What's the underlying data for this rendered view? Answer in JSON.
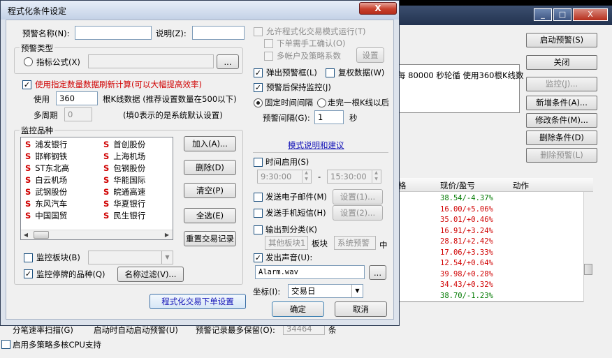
{
  "dialog": {
    "title": "程式化条件设定",
    "close_symbol": "X",
    "alert_name_label": "预警名称(N):",
    "alert_name_value": "",
    "description_label": "说明(Z):",
    "description_value": "",
    "alert_type": {
      "group_title": "预警类型",
      "formula_label": "指标公式(X)",
      "formula_value": "",
      "browse_label": "..."
    },
    "refresh": {
      "checkbox_label": "使用指定数量数据刷新计算(可以大幅提高效率)",
      "use_label": "使用",
      "count_value": "360",
      "count_suffix": "根K线数据 (推荐设置数量在500以下)",
      "multi_period_label": "多周期",
      "multi_period_value": "0",
      "multi_period_hint": "(填0表示的是系统默认设置)"
    },
    "stocks": {
      "group_title": "监控品种",
      "column_left": [
        "浦发银行",
        "邯郸钢铁",
        "ST东北高",
        "白云机场",
        "武钢股份",
        "东风汽车",
        "中国国贸"
      ],
      "column_right": [
        "首创股份",
        "上海机场",
        "包钢股份",
        "华能国际",
        "皖通高速",
        "华夏银行",
        "民生银行"
      ],
      "marker": "S",
      "buttons": [
        "加入(A)...",
        "删除(D)",
        "清空(P)",
        "全选(E)",
        "重置交易记录"
      ],
      "monitor_sector_label": "监控板块(B)",
      "monitor_sector_value": "",
      "monitor_suspended_label": "监控停牌的品种(Q)",
      "name_filter_label": "名称过滤(V)..."
    },
    "order_settings_button": "程式化交易下单设置",
    "right": {
      "allow_trade_mode_label": "允许程式化交易模式运行(T)",
      "manual_confirm_label": "下单需手工确认(O)",
      "multi_account_label": "多帐户及策略系数",
      "settings_button": "设置",
      "popup_label": "弹出预警框(L)",
      "rights_data_label": "复权数据(W)",
      "keep_monitor_label": "预警后保持监控(J)",
      "fixed_interval_label": "固定时间间隔",
      "after_bar_label": "走完一根K线以后",
      "interval_label": "预警间隔(G):",
      "interval_value": "1",
      "interval_unit": "秒",
      "mode_link": "模式说明和建议",
      "time_enable_label": "时间启用(S)",
      "time_start": "9:30:00",
      "time_sep": "-",
      "time_end": "15:30:00",
      "email_label": "发送电子邮件(M)",
      "email_button": "设置(1)...",
      "sms_label": "发送手机短信(H)",
      "sms_button": "设置(2)...",
      "output_label": "输出到分类(K)",
      "output_sector": "其他板块1",
      "output_sector_suffix": "板块",
      "output_system": "系统预警",
      "output_suffix": "中",
      "sound_label": "发出声音(U):",
      "sound_file": "Alarm.wav",
      "sound_browse": "...",
      "coord_label": "坐标(I):",
      "coord_value": "交易日",
      "ok_button": "确定",
      "cancel_button": "取消"
    }
  },
  "background": {
    "window_buttons": [
      "_",
      "□",
      "X"
    ],
    "info_text": "每 80000 秒轮循 使用360根K线数",
    "right_buttons": [
      "启动预警(S)",
      "关闭",
      "监控(J)...",
      "新增条件(A)...",
      "修改条件(M)...",
      "删除条件(D)",
      "删除预警(L)"
    ],
    "table_headers": [
      "格",
      "现价/盈亏",
      "动作"
    ],
    "table_rows": [
      {
        "value": "38.54/-4.37%",
        "color": "#007a00"
      },
      {
        "value": "16.00/+5.06%",
        "color": "#d00000"
      },
      {
        "value": "35.01/+0.46%",
        "color": "#d00000"
      },
      {
        "value": "16.91/+3.24%",
        "color": "#d00000"
      },
      {
        "value": "28.81/+2.42%",
        "color": "#d00000"
      },
      {
        "value": "17.06/+3.33%",
        "color": "#d00000"
      },
      {
        "value": "12.54/+0.64%",
        "color": "#d00000"
      },
      {
        "value": "39.98/+0.28%",
        "color": "#d00000"
      },
      {
        "value": "34.43/+0.32%",
        "color": "#d00000"
      },
      {
        "value": "38.70/-1.23%",
        "color": "#007a00"
      }
    ],
    "bottom": {
      "scan_label": "分笔速率扫描(G)",
      "auto_start_label": "启动时自动启动预警(U)",
      "record_max_label": "预警记录最多保留(O):",
      "record_max_value": "34464",
      "record_unit": "条",
      "multi_core_label": "启用多策略多核CPU支持"
    }
  }
}
